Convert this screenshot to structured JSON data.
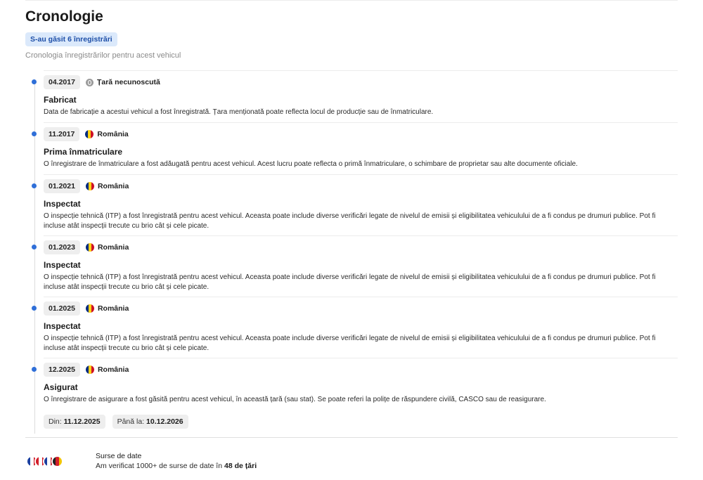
{
  "title": "Cronologie",
  "badge": "S-au găsit 6 înregistrări",
  "subtitle": "Cronologia înregistrărilor pentru acest vehicul",
  "entries": [
    {
      "date": "04.2017",
      "country": "Țară necunoscută",
      "flag": "unknown",
      "title": "Fabricat",
      "description": "Data de fabricație a acestui vehicul a fost înregistrată. Țara menționată poate reflecta locul de producție sau de înmatriculare."
    },
    {
      "date": "11.2017",
      "country": "România",
      "flag": "ro",
      "title": "Prima înmatriculare",
      "description": "O înregistrare de înmatriculare a fost adăugată pentru acest vehicul. Acest lucru poate reflecta o primă înmatriculare, o schimbare de proprietar sau alte documente oficiale."
    },
    {
      "date": "01.2021",
      "country": "România",
      "flag": "ro",
      "title": "Inspectat",
      "description": "O inspecție tehnică (ITP) a fost înregistrată pentru acest vehicul. Aceasta poate include diverse verificări legate de nivelul de emisii și eligibilitatea vehiculului de a fi condus pe drumuri publice. Pot fi incluse atât inspecții trecute cu brio cât și cele picate."
    },
    {
      "date": "01.2023",
      "country": "România",
      "flag": "ro",
      "title": "Inspectat",
      "description": "O inspecție tehnică (ITP) a fost înregistrată pentru acest vehicul. Aceasta poate include diverse verificări legate de nivelul de emisii și eligibilitatea vehiculului de a fi condus pe drumuri publice. Pot fi incluse atât inspecții trecute cu brio cât și cele picate."
    },
    {
      "date": "01.2025",
      "country": "România",
      "flag": "ro",
      "title": "Inspectat",
      "description": "O inspecție tehnică (ITP) a fost înregistrată pentru acest vehicul. Aceasta poate include diverse verificări legate de nivelul de emisii și eligibilitatea vehiculului de a fi condus pe drumuri publice. Pot fi incluse atât inspecții trecute cu brio cât și cele picate."
    },
    {
      "date": "12.2025",
      "country": "România",
      "flag": "ro",
      "title": "Asigurat",
      "description": "O înregistrare de asigurare a fost găsită pentru acest vehicul, în această țară (sau stat). Se poate referi la polițe de răspundere civilă, CASCO sau de reasigurare.",
      "from_label": "Din:",
      "from_value": "11.12.2025",
      "to_label": "Până la:",
      "to_value": "10.12.2026"
    }
  ],
  "sources": {
    "title": "Surse de date",
    "text_before": "Am verificat 1000+ de surse de date în",
    "text_bold": "48 de țări"
  },
  "colors": {
    "accent": "#2f6fd8",
    "badge_bg": "#dbe9fb",
    "ro_blue": "#002b7f",
    "ro_yellow": "#fcd116",
    "ro_red": "#ce1126"
  }
}
